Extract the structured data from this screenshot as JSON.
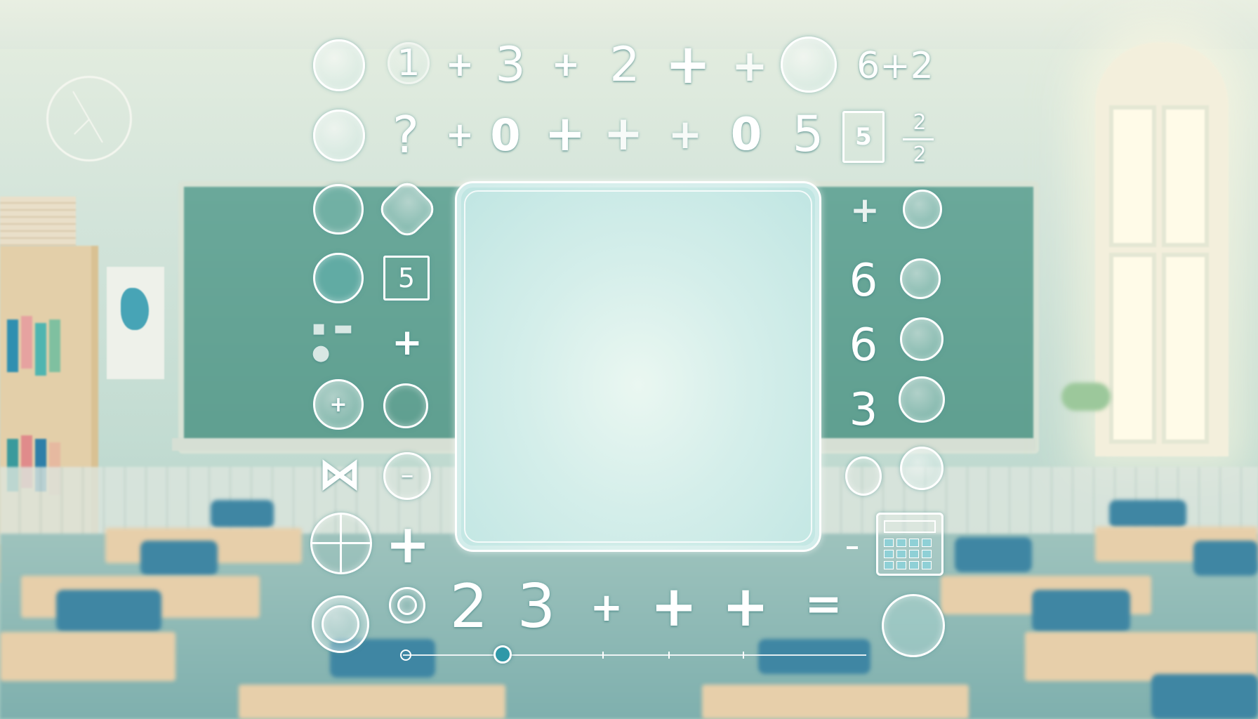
{
  "top_row": [
    "1",
    "+",
    "3",
    "+",
    "2",
    "+",
    "+",
    "6+2"
  ],
  "second_row": [
    "?",
    "+",
    "0",
    "+",
    "+",
    "+",
    "0",
    "5",
    "5",
    "2",
    "2"
  ],
  "left_col": [
    "+",
    "5",
    "+",
    "+"
  ],
  "right_col": [
    "+",
    "6",
    "6",
    "3"
  ],
  "bottom_row": [
    "2",
    "3",
    "+",
    "+",
    "+",
    "="
  ],
  "colors": {
    "accent": "#2f98a8",
    "panel": "#d4eeea",
    "chalkboard": "#62a293"
  },
  "icons": [
    "globe-icon",
    "calculator-icon",
    "clock-icon",
    "plus-icon",
    "circle-icon"
  ]
}
